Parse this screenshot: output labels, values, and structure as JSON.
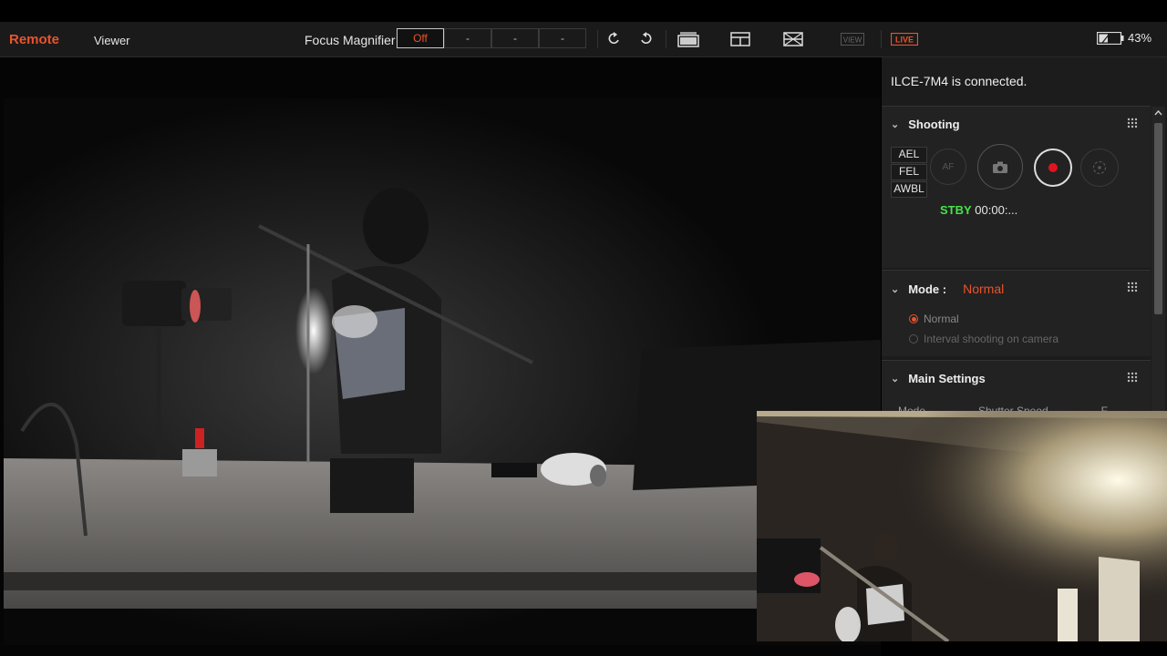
{
  "app": {
    "brand": "Remote",
    "tab_viewer": "Viewer"
  },
  "toolbar": {
    "focus_magnifier_label": "Focus Magnifier",
    "focus_options": [
      "Off",
      "-",
      "-",
      "-"
    ],
    "view_badge": "VIEW",
    "live_badge": "LIVE",
    "battery": "43%",
    "battery_level": 0.43
  },
  "panel": {
    "connection": "ILCE-7M4 is connected.",
    "shooting": {
      "title": "Shooting",
      "lock_buttons": [
        "AEL",
        "FEL",
        "AWBL"
      ],
      "af_label": "AF",
      "status_label": "STBY",
      "timecode": "00:00:..."
    },
    "mode": {
      "title": "Mode :",
      "value": "Normal",
      "options": [
        "Normal",
        "Interval shooting on camera"
      ]
    },
    "main_settings": {
      "title": "Main Settings",
      "cut_row": [
        "Mode",
        "Shutter Speed",
        "F"
      ]
    }
  },
  "colors": {
    "accent": "#e8542c",
    "standby": "#48e24a",
    "record": "#e0141e"
  }
}
